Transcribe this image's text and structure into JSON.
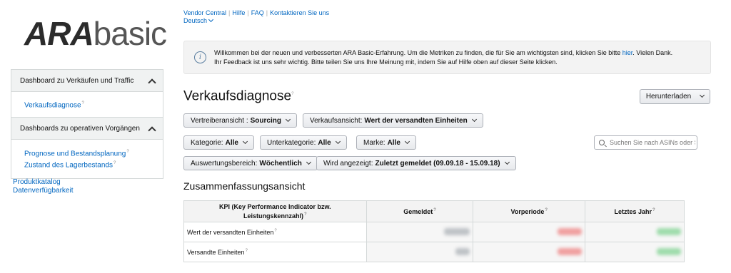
{
  "logo": {
    "bold": "ARA",
    "thin": "basic"
  },
  "sidebar": {
    "sections": [
      {
        "label": "Dashboard zu Verkäufen und Traffic",
        "links": [
          "Verkaufsdiagnose"
        ]
      },
      {
        "label": "Dashboards zu operativen Vorgängen",
        "links": [
          "Prognose und Bestandsplanung",
          "Zustand des Lagerbestands"
        ]
      }
    ],
    "extra_links": [
      "Produktkatalog",
      "Datenverfügbarkeit"
    ]
  },
  "top_links": [
    "Vendor Central",
    "Hilfe",
    "FAQ",
    "Kontaktieren Sie uns"
  ],
  "language": "Deutsch",
  "banner": {
    "line1_before": "Willkommen bei der neuen und verbesserten ARA Basic-Erfahrung. Um die Metriken zu finden, die für Sie am wichtigsten sind, klicken Sie bitte ",
    "link": "hier",
    "line1_after": ". Vielen Dank.",
    "line2": "Ihr Feedback ist uns sehr wichtig. Bitte teilen Sie uns Ihre Meinung mit, indem Sie auf Hilfe oben auf dieser Seite klicken."
  },
  "page_title": "Verkaufsdiagnose",
  "download_label": "Herunterladen",
  "filters": {
    "distributor": {
      "label": "Vertreiberansicht :",
      "value": "Sourcing"
    },
    "sales_view": {
      "label": "Verkaufsansicht:",
      "value": "Wert der versandten Einheiten"
    },
    "category": {
      "label": "Kategorie:",
      "value": "Alle"
    },
    "subcategory": {
      "label": "Unterkategorie:",
      "value": "Alle"
    },
    "brand": {
      "label": "Marke:",
      "value": "Alle"
    },
    "range": {
      "label": "Auswertungsbereich:",
      "value": "Wöchentlich"
    },
    "shown": {
      "label": "Wird angezeigt:",
      "value": "Zuletzt gemeldet (09.09.18 - 15.09.18)"
    }
  },
  "search": {
    "placeholder": "Suchen Sie nach ASINs oder Stichwörtern"
  },
  "summary_title": "Zusammenfassungsansicht",
  "table": {
    "headers": [
      "KPI (Key Performance Indicator bzw. Leistungskennzahl)",
      "Gemeldet",
      "Vorperiode",
      "Letztes Jahr"
    ],
    "rows": [
      {
        "kpi": "Wert der versandten Einheiten"
      },
      {
        "kpi": "Versandte Einheiten"
      }
    ]
  }
}
